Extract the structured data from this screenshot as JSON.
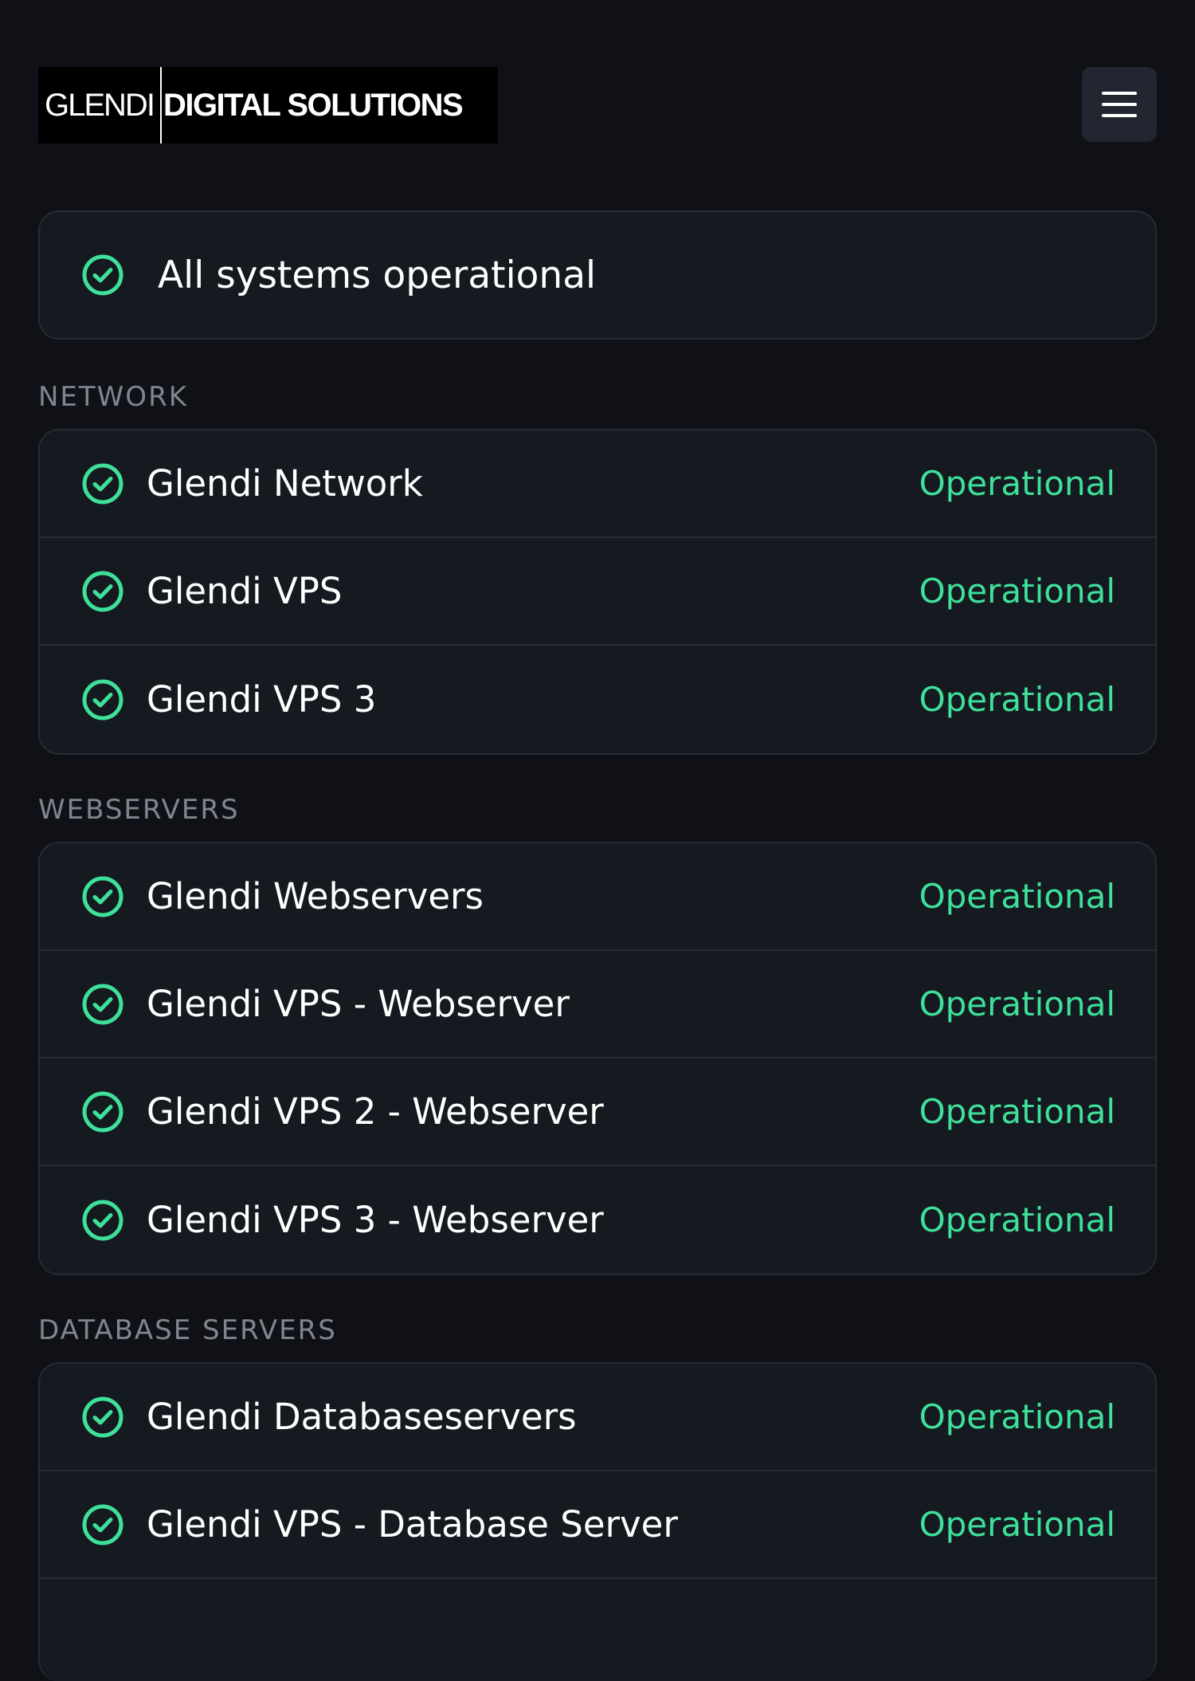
{
  "brand": {
    "logo_part1": "GLENDI",
    "logo_part2": "DIGITAL SOLUTIONS"
  },
  "header": {
    "menu_icon": "hamburger-menu-icon"
  },
  "colors": {
    "background": "#0f1116",
    "card": "#151920",
    "border": "#262b34",
    "operational": "#3ee09a",
    "section_title": "#80858f"
  },
  "banner": {
    "icon": "check-circle-icon",
    "text": "All systems operational"
  },
  "sections": [
    {
      "title": "NETWORK",
      "services": [
        {
          "name": "Glendi Network",
          "status": "Operational"
        },
        {
          "name": "Glendi VPS",
          "status": "Operational"
        },
        {
          "name": "Glendi VPS 3",
          "status": "Operational"
        }
      ]
    },
    {
      "title": "WEBSERVERS",
      "services": [
        {
          "name": "Glendi Webservers",
          "status": "Operational"
        },
        {
          "name": "Glendi VPS - Webserver",
          "status": "Operational"
        },
        {
          "name": "Glendi VPS 2 - Webserver",
          "status": "Operational"
        },
        {
          "name": "Glendi VPS 3 - Webserver",
          "status": "Operational"
        }
      ]
    },
    {
      "title": "DATABASE SERVERS",
      "services": [
        {
          "name": "Glendi Databaseservers",
          "status": "Operational"
        },
        {
          "name": "Glendi VPS - Database Server",
          "status": "Operational"
        }
      ]
    }
  ]
}
